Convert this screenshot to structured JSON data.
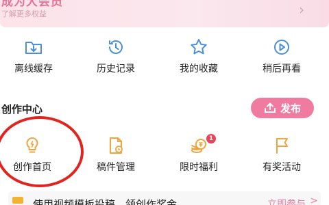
{
  "vip": {
    "title": "成为大会员",
    "subtitle": "了解更多权益",
    "chevron": "›"
  },
  "quick_actions": [
    {
      "label": "离线缓存",
      "icon": "offline-download-icon"
    },
    {
      "label": "历史记录",
      "icon": "history-clock-icon"
    },
    {
      "label": "我的收藏",
      "icon": "star-icon"
    },
    {
      "label": "稍后再看",
      "icon": "watch-later-icon"
    }
  ],
  "creation_center": {
    "title": "创作中心",
    "publish_label": "发布",
    "items": [
      {
        "label": "创作首页",
        "icon": "lightbulb-icon"
      },
      {
        "label": "稿件管理",
        "icon": "manuscript-icon"
      },
      {
        "label": "限时福利",
        "icon": "coins-icon",
        "badge": "1"
      },
      {
        "label": "有奖活动",
        "icon": "flag-icon"
      }
    ]
  },
  "bottom_banner": {
    "text": "使用视频模板投稿，领创作奖金",
    "action": "立即参与",
    "chevron": ">"
  },
  "colors": {
    "accent": "#f07ba0",
    "icon_blue": "#4a8fd8",
    "icon_orange": "#f2a33a",
    "badge_red": "#e8455b",
    "highlight_red": "#e2241f",
    "vip_pink": "#e37399"
  }
}
